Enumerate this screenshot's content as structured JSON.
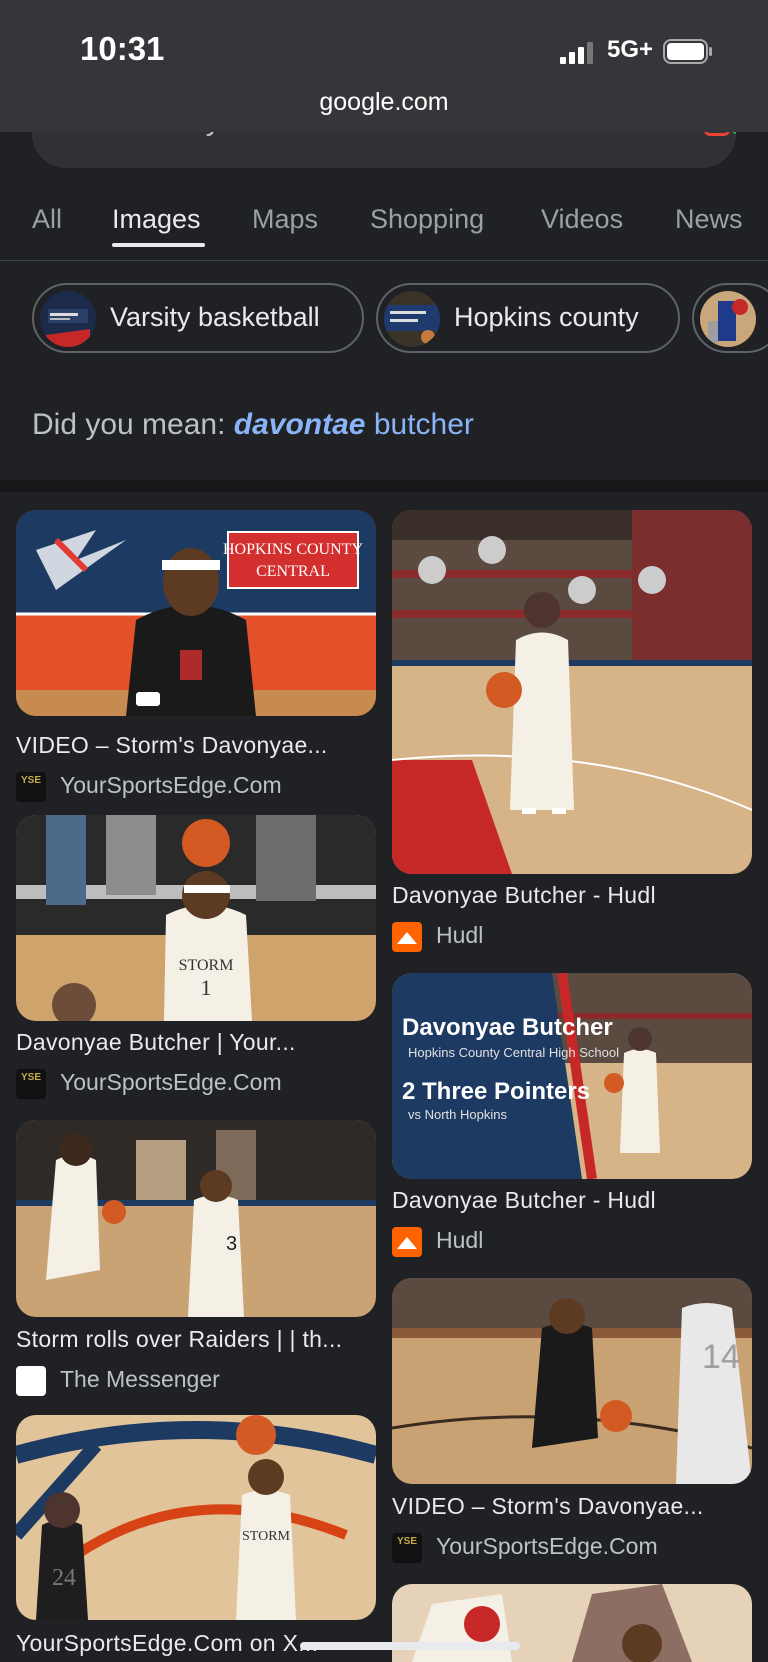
{
  "status": {
    "time": "10:31",
    "network": "5G+"
  },
  "browser": {
    "url": "google.com"
  },
  "search": {
    "query": "davonyae butcher"
  },
  "tabs": [
    {
      "label": "All"
    },
    {
      "label": "Images"
    },
    {
      "label": "Maps"
    },
    {
      "label": "Shopping"
    },
    {
      "label": "Videos"
    },
    {
      "label": "News"
    }
  ],
  "chips": [
    {
      "label": "Varsity basketball"
    },
    {
      "label": "Hopkins county"
    }
  ],
  "did_you_mean": {
    "prefix": "Did you mean:",
    "suggestion_emph": "davontae",
    "suggestion_rest": "butcher"
  },
  "results": [
    {
      "title": "VIDEO – Storm's Davonyae...",
      "source": "YourSportsEdge.Com",
      "banner": "HOPKINS COUNTY CENTRAL"
    },
    {
      "title": "Davonyae Butcher - Hudl",
      "source": "Hudl"
    },
    {
      "title": "Davonyae Butcher | Your...",
      "source": "YourSportsEdge.Com"
    },
    {
      "title": "Davonyae Butcher - Hudl",
      "source": "Hudl",
      "overlay_name": "Davonyae Butcher",
      "overlay_school": "Hopkins County Central High School",
      "overlay_stat": "2 Three Pointers",
      "overlay_vs": "vs North Hopkins"
    },
    {
      "title": "Storm rolls over Raiders | | th...",
      "source": "The Messenger"
    },
    {
      "title": "VIDEO – Storm's Davonyae...",
      "source": "YourSportsEdge.Com"
    },
    {
      "title": "YourSportsEdge.Com on X..."
    }
  ],
  "favicons": {
    "yse": "YSE"
  },
  "colors": {
    "background": "#202124",
    "accent_blue": "#8ab4f8",
    "hudl_orange": "#ff6300"
  }
}
